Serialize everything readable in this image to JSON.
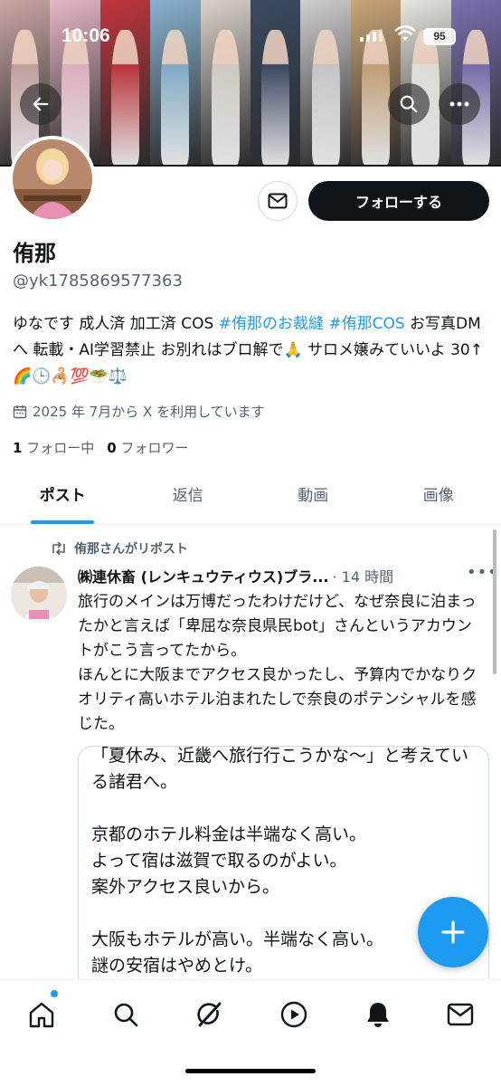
{
  "status_bar": {
    "time": "10:06",
    "battery": "95"
  },
  "header": {
    "back_icon": "back-arrow-icon",
    "search_icon": "search-icon",
    "more_icon": "more-icon",
    "banner_colors": [
      "#c9a6a4",
      "#e6b7c6",
      "#c0353b",
      "#87b2cf",
      "#d9d2cb",
      "#3b4a63",
      "#cfcdd0",
      "#c9a578",
      "#e9e6e0",
      "#7a6fb0"
    ]
  },
  "profile": {
    "name": "侑那",
    "handle": "@yk1785869577363",
    "follow_label": "フォローする",
    "bio_parts": [
      {
        "text": "ゆなです 成人済 加工済 COS ",
        "type": "text"
      },
      {
        "text": "#侑那のお裁縫",
        "type": "tag"
      },
      {
        "text": " ",
        "type": "text"
      },
      {
        "text": "#侑那COS",
        "type": "tag"
      },
      {
        "text": " お写真DMへ 転載・AI学習禁止 お別れはブロ解で🙏 サロメ嬢みていいよ 30↑ 🌈🕒🦂💯🥗⚖️",
        "type": "text"
      }
    ],
    "joined": "2025 年 7月から X を利用しています",
    "following_count": "1",
    "following_label": "フォロー中",
    "followers_count": "0",
    "followers_label": "フォロワー"
  },
  "tabs": [
    {
      "label": "ポスト",
      "active": true
    },
    {
      "label": "返信",
      "active": false
    },
    {
      "label": "動画",
      "active": false
    },
    {
      "label": "画像",
      "active": false
    }
  ],
  "post": {
    "repost_label": "侑那さんがリポスト",
    "author": "㈱連休畜 (レンキュウティウス)ブラ...",
    "time": "· 14 時間",
    "text": "旅行のメインは万博だったわけだけど、なぜ奈良に泊まったかと言えば「卑屈な奈良県民bot」さんというアカウントがこう言ってたから。\nほんとに大阪までアクセス良かったし、予算内でかなりクオリティ高いホテル泊まれたしで奈良のポテンシャルを感じた。",
    "quote_text": "「夏休み、近畿へ旅行行こうかな～」と考えている諸君へ。\n\n京都のホテル料金は半端なく高い。\nよって宿は滋賀で取るのがよい。\n案外アクセス良いから。\n\n大阪もホテルが高い。半端なく高い。\n謎の安宿はやめとけ。\nよって奈良で宿を取ろう。"
  },
  "bottom_nav": [
    {
      "name": "home-icon"
    },
    {
      "name": "search-icon"
    },
    {
      "name": "grok-icon"
    },
    {
      "name": "video-icon"
    },
    {
      "name": "notifications-icon"
    },
    {
      "name": "messages-icon"
    }
  ],
  "colors": {
    "accent": "#1d9bf0",
    "text": "#0f1419",
    "muted": "#536471"
  }
}
